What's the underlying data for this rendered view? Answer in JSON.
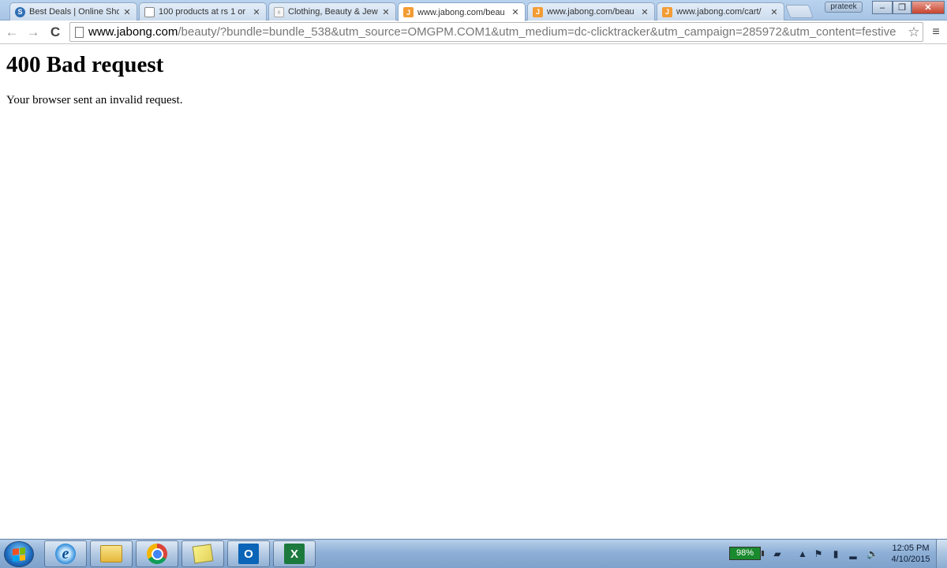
{
  "tabs": [
    {
      "title": "Best Deals | Online Sho",
      "favicon": "blue-circle-s-icon",
      "favicon_text": "S",
      "active": false
    },
    {
      "title": "100 products at rs 1 or",
      "favicon": "document-icon",
      "favicon_text": "",
      "active": false
    },
    {
      "title": "Clothing, Beauty & Jew",
      "favicon": "shopping-bag-icon",
      "favicon_text": "",
      "active": false
    },
    {
      "title": "www.jabong.com/beau",
      "favicon": "jabong-j-icon",
      "favicon_text": "J",
      "active": true
    },
    {
      "title": "www.jabong.com/beau",
      "favicon": "jabong-j-icon",
      "favicon_text": "J",
      "active": false
    },
    {
      "title": "www.jabong.com/cart/",
      "favicon": "jabong-j-icon",
      "favicon_text": "J",
      "active": false
    }
  ],
  "window": {
    "profile_name": "prateek",
    "minimize": "–",
    "maximize": "❐",
    "close": "✕"
  },
  "toolbar": {
    "back": "←",
    "forward": "→",
    "reload": "C",
    "url_host": "www.jabong.com",
    "url_rest": "/beauty/?bundle=bundle_538&utm_source=OMGPM.COM1&utm_medium=dc-clicktracker&utm_campaign=285972&utm_content=festive",
    "star": "☆",
    "menu": "≡"
  },
  "page": {
    "heading": "400 Bad request",
    "message": "Your browser sent an invalid request."
  },
  "taskbar": {
    "apps": [
      "internet-explorer",
      "file-explorer",
      "chrome",
      "sticky-notes",
      "outlook",
      "excel"
    ],
    "outlook_letter": "O",
    "excel_letter": "X",
    "battery": "98%",
    "time": "12:05 PM",
    "date": "4/10/2015"
  }
}
